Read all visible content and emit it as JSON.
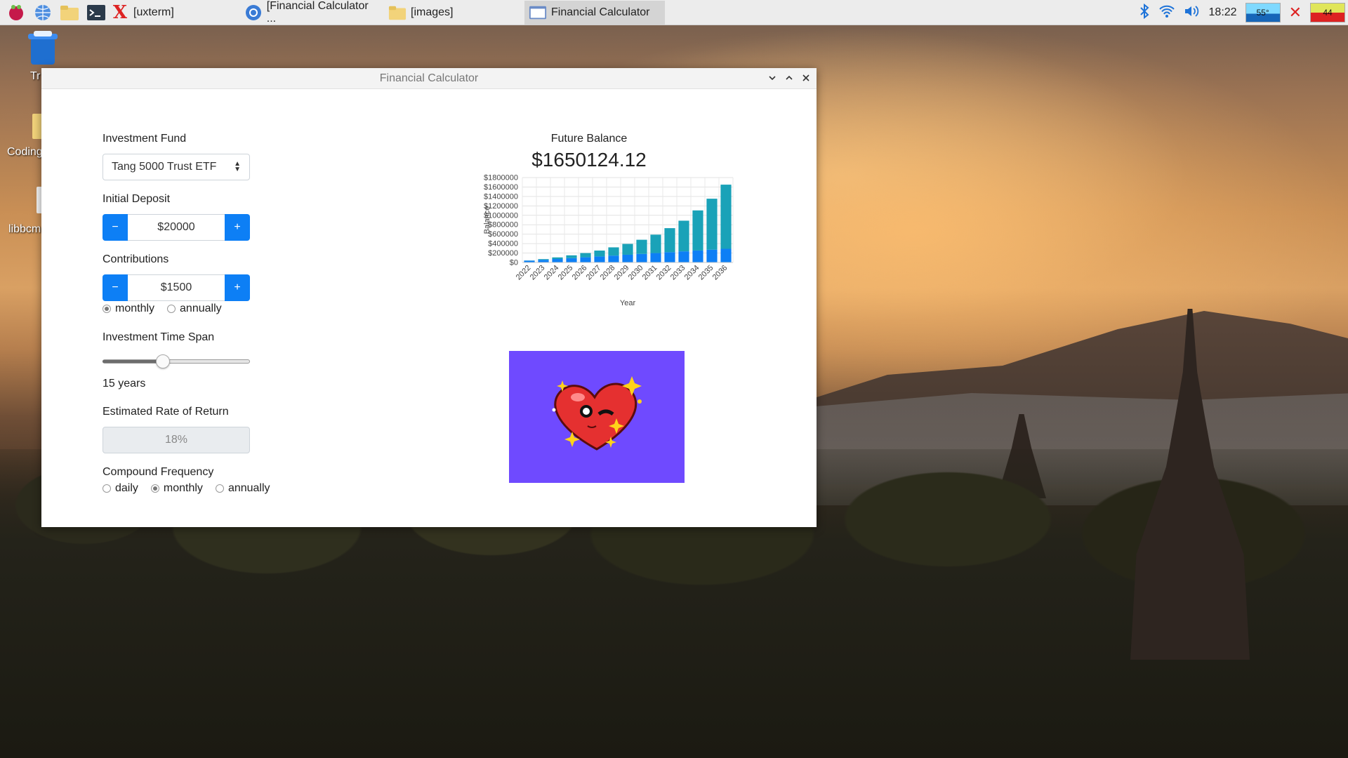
{
  "taskbar": {
    "tasks": [
      {
        "label": "[uxterm]"
      },
      {
        "label": "[Financial Calculator ..."
      },
      {
        "label": "[images]"
      },
      {
        "label": "Financial Calculator"
      }
    ],
    "clock": "18:22",
    "cpu_temp": "55°",
    "cpu_load": "44"
  },
  "desktop": {
    "icons": [
      {
        "label": "Tr"
      },
      {
        "label": "Coding"
      },
      {
        "label": "libbcm"
      }
    ]
  },
  "window": {
    "title": "Financial Calculator"
  },
  "form": {
    "fund_label": "Investment Fund",
    "fund_value": "Tang 5000 Trust ETF",
    "deposit_label": "Initial Deposit",
    "deposit_value": "$20000",
    "contrib_label": "Contributions",
    "contrib_value": "$1500",
    "minus": "−",
    "plus": "+",
    "contrib_freq": [
      "monthly",
      "annually"
    ],
    "contrib_freq_selected": "monthly",
    "timespan_label": "Investment Time Span",
    "timespan_value": "15 years",
    "timespan_fraction": 0.5,
    "rate_label": "Estimated Rate of Return",
    "rate_value": "18%",
    "compound_label": "Compound Frequency",
    "compound_options": [
      "daily",
      "monthly",
      "annually"
    ],
    "compound_selected": "monthly"
  },
  "result": {
    "label": "Future Balance",
    "value": "$1650124.12"
  },
  "chart_data": {
    "type": "bar",
    "stacked": true,
    "xlabel": "Year",
    "ylabel": "Balance",
    "ylim": [
      0,
      1800000
    ],
    "yticks": [
      "$0",
      "$200000",
      "$400000",
      "$600000",
      "$800000",
      "$1000000",
      "$1200000",
      "$1400000",
      "$1600000",
      "$1800000"
    ],
    "categories": [
      "2022",
      "2023",
      "2024",
      "2025",
      "2026",
      "2027",
      "2028",
      "2029",
      "2030",
      "2031",
      "2032",
      "2033",
      "2034",
      "2035",
      "2036"
    ],
    "series": [
      {
        "values": [
          38000,
          56000,
          74000,
          92000,
          110000,
          128000,
          146000,
          164000,
          182000,
          200000,
          218000,
          236000,
          254000,
          272000,
          290000
        ],
        "color": "#0d7ff5"
      },
      {
        "values": [
          4000,
          16000,
          34000,
          60000,
          90000,
          125000,
          175000,
          230000,
          300000,
          390000,
          510000,
          650000,
          850000,
          1080000,
          1360000
        ],
        "color": "#1aa2b8"
      }
    ],
    "grid": true
  }
}
